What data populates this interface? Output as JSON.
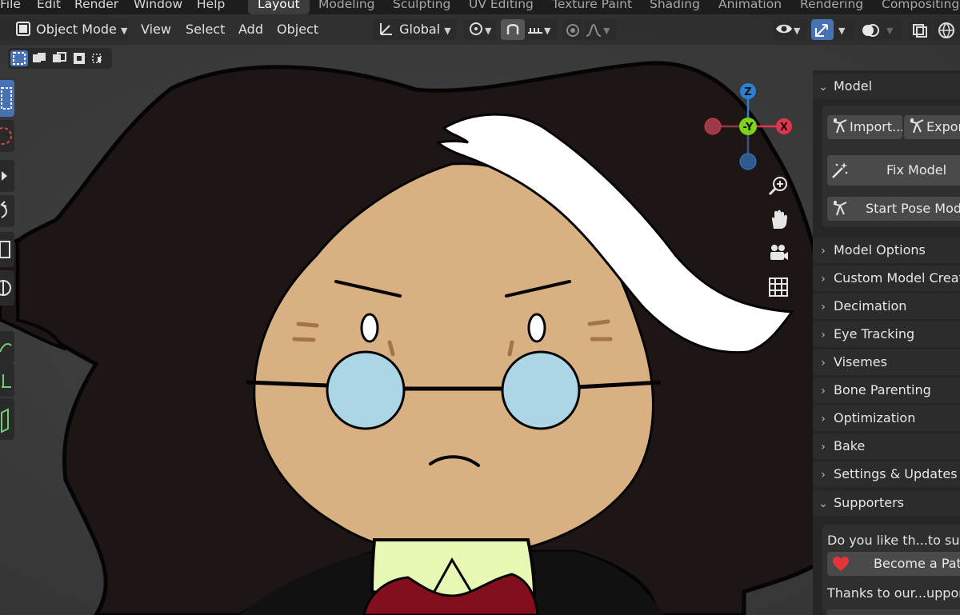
{
  "top_menu": {
    "items": [
      "File",
      "Edit",
      "Render",
      "Window",
      "Help"
    ]
  },
  "workspaces": {
    "tabs": [
      "Layout",
      "Modeling",
      "Sculpting",
      "UV Editing",
      "Texture Paint",
      "Shading",
      "Animation",
      "Rendering",
      "Compositing"
    ],
    "active": "Layout"
  },
  "viewport_header": {
    "mode": "Object Mode",
    "menus": [
      "View",
      "Select",
      "Add",
      "Object"
    ],
    "transform_orientation": "Global"
  },
  "gizmo": {
    "axes": [
      "Z",
      "-Y",
      "X"
    ],
    "colors": {
      "x": "#e2354b",
      "y": "#7bd31a",
      "z": "#2a80d5"
    }
  },
  "navigation": {
    "icons": [
      "zoom-icon",
      "pan-hand-icon",
      "camera-icon",
      "ortho-grid-icon"
    ]
  },
  "sidebar": {
    "model_panel": {
      "title": "Model",
      "import_label": "Import...",
      "export_label": "Export",
      "fix_model_label": "Fix Model",
      "pose_mode_label": "Start Pose Mode"
    },
    "collapsed_panels": [
      "Model Options",
      "Custom Model Creation",
      "Decimation",
      "Eye Tracking",
      "Visemes",
      "Bone Parenting",
      "Optimization",
      "Bake",
      "Settings & Updates"
    ],
    "supporters_panel": {
      "title": "Supporters",
      "question": "Do you like th...to support",
      "patron_label": "Become a Patron",
      "thanks": "Thanks to our...upporters"
    }
  },
  "colors": {
    "accent_blue": "#4772b3",
    "skin": "#d8b081",
    "hair": "#1e1614",
    "lens": "#acd6e6",
    "bowtie": "#840f1c",
    "heart": "#e2343a"
  }
}
